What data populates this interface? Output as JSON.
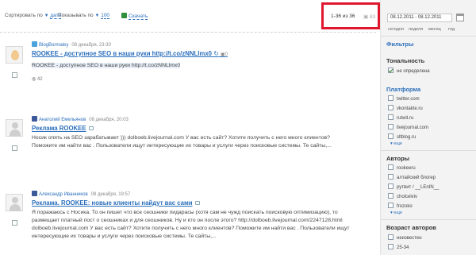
{
  "toolbar": {
    "sort_label": "Сортировать по",
    "sort_value": "дате",
    "show_label": "Показывать по",
    "show_value": "100",
    "export_label": "Скачать"
  },
  "pager": {
    "range_text": "1-36 из 36",
    "icon_count": "83"
  },
  "posts": [
    {
      "source": "twitter",
      "author": "BlogBormaley",
      "date": "08 декабря, 23:30",
      "title": "ROOKEE - доступное SEO в наши руки http://t.co/zNNLlmx0",
      "title_icon_count": "0",
      "body": "ROOKEE - доступное SEO в наши руки http://t.co/zNNLlmx0",
      "counter": "42"
    },
    {
      "source": "facebook",
      "author": "Анатолий Емельянов",
      "date": "08 декабря, 20:03",
      "title": "Реклама ROOKEE",
      "body": "Носик опять на SEO зарабатывает ))) dolboeb.livejournal.com У вас есть сайт? Хотите получить с него много клиентов? Поможите им найти вас . Пользователи ищут интересующие их товары и услуги через поисковые системы. Те сайты,..."
    },
    {
      "source": "facebook",
      "author": "Александр Иванников",
      "date": "08 декабря, 19:57",
      "title": "Реклама. ROOKEE: новые клиенты найдут вас сами",
      "body": "Я поражаюсь с Носика. То он пишет что все сеошники пидарасы (хотя сам не чужд поискать поисковую оптимизацию), то размещает платный пост о сеошниках и для сеошников. Ну и кто он после этого? http://dolboeb.livejournal.com/2247128.html dolboeb.livejournal.com У вас есть сайт? Хотите получить с него много клиентов? Поможите им найти вас . Пользователи ищут интересующие их товары и услуги через поисковые системы. Те сайты,..."
    }
  ],
  "sidebar": {
    "date_range": "08.12.2011 - 08.12.2011",
    "periods": [
      "сегодня",
      "неделя",
      "месяц",
      "год"
    ],
    "filters_title": "Фильтры",
    "tonality": {
      "title": "Тональность",
      "items": [
        {
          "label": "не определена",
          "checked": true
        }
      ]
    },
    "platform": {
      "title": "Платформа",
      "items": [
        "twitter.com",
        "vkontakte.ru",
        "rutwit.ru",
        "livejournal.com",
        "sltblog.ru"
      ],
      "more": "еще"
    },
    "authors": {
      "title": "Авторы",
      "items": [
        "rookeeru",
        "алтайский блогер",
        "рутвит / __LEnIN__",
        "cholcelviv",
        "frozoko"
      ],
      "more": "еще"
    },
    "author_age": {
      "title": "Возраст авторов",
      "items": [
        "неизвестен",
        "25-34"
      ]
    }
  }
}
